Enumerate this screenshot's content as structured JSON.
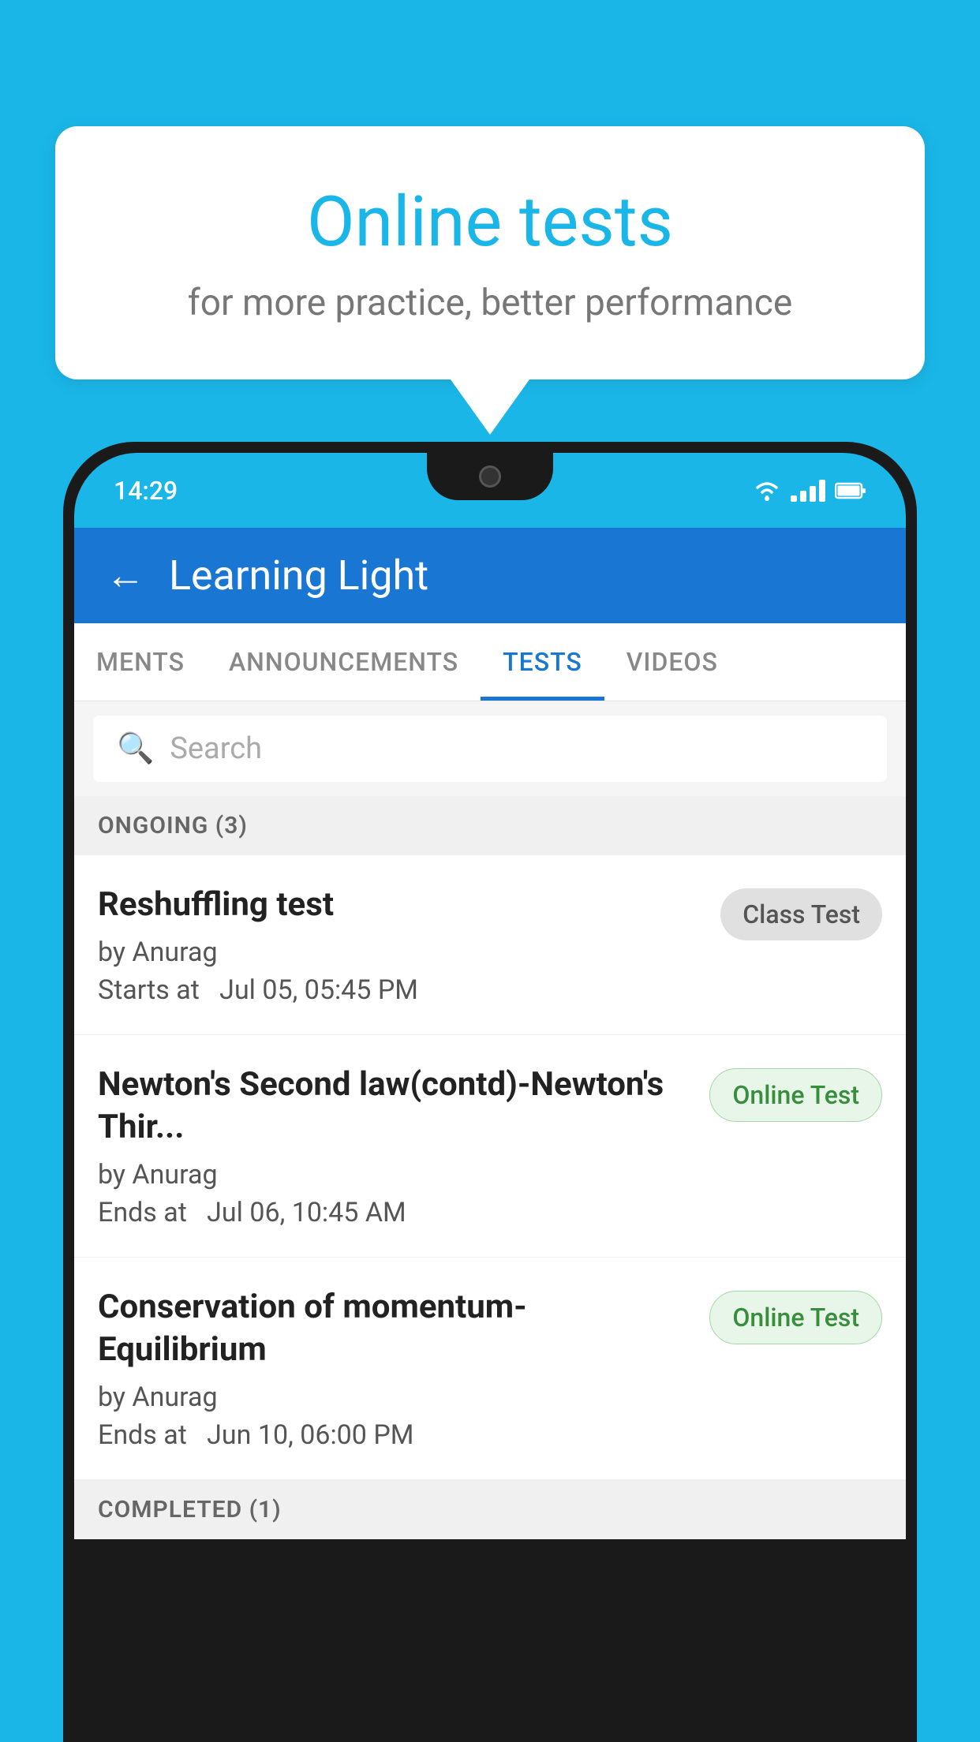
{
  "background_color": "#1ab6e8",
  "speech_bubble": {
    "title": "Online tests",
    "subtitle": "for more practice, better performance"
  },
  "phone": {
    "status_bar": {
      "time": "14:29",
      "icons": [
        "wifi",
        "signal",
        "battery"
      ]
    },
    "app_header": {
      "back_label": "←",
      "title": "Learning Light"
    },
    "tabs": [
      {
        "label": "MENTS",
        "active": false
      },
      {
        "label": "ANNOUNCEMENTS",
        "active": false
      },
      {
        "label": "TESTS",
        "active": true
      },
      {
        "label": "VIDEOS",
        "active": false
      }
    ],
    "search": {
      "placeholder": "Search",
      "icon": "🔍"
    },
    "ongoing_section": {
      "label": "ONGOING (3)",
      "tests": [
        {
          "name": "Reshuffling test",
          "author": "by Anurag",
          "date": "Starts at  Jul 05, 05:45 PM",
          "badge": "Class Test",
          "badge_type": "class"
        },
        {
          "name": "Newton's Second law(contd)-Newton's Thir...",
          "author": "by Anurag",
          "date": "Ends at  Jul 06, 10:45 AM",
          "badge": "Online Test",
          "badge_type": "online"
        },
        {
          "name": "Conservation of momentum-Equilibrium",
          "author": "by Anurag",
          "date": "Ends at  Jun 10, 06:00 PM",
          "badge": "Online Test",
          "badge_type": "online"
        }
      ]
    },
    "completed_section": {
      "label": "COMPLETED (1)"
    }
  }
}
